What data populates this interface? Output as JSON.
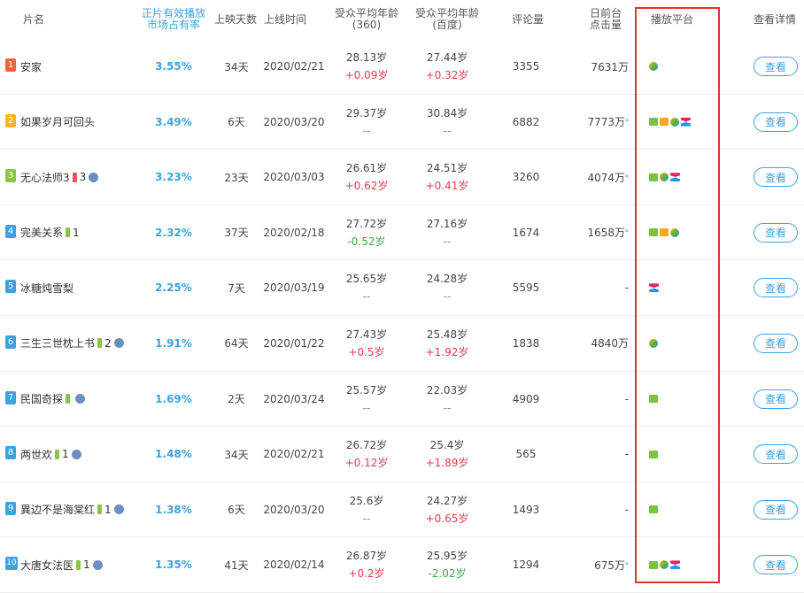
{
  "headers": {
    "name": "片名",
    "share_line1": "正片有效播放",
    "share_line2": "市场占有率",
    "days": "上映天数",
    "date": "上线时间",
    "age360_line1": "受众平均年龄",
    "age360_line2": "(360)",
    "agebaidu_line1": "受众平均年龄",
    "agebaidu_line2": "(百度)",
    "comments": "评论量",
    "views_line1": "日前台",
    "views_line2": "点击量",
    "platform": "播放平台",
    "details": "查看详情"
  },
  "view_button_label": "查看",
  "colors": {
    "accent": "#3ea2dd",
    "up": "#e23c4b",
    "down": "#3aa845",
    "highlight": "#e53030"
  },
  "rows": [
    {
      "rank": "1",
      "rank_color": "#f0663c",
      "title": "安家",
      "badges": [],
      "share": "3.55%",
      "days": "34天",
      "date": "2020/02/21",
      "age360": "28.13岁",
      "age360_delta": "+0.09岁",
      "age360_dir": "up",
      "agebaidu": "27.44岁",
      "agebaidu_delta": "+0.32岁",
      "agebaidu_dir": "up",
      "comments": "3355",
      "views": "7631万",
      "views_mark": "",
      "platforms": [
        "tencent"
      ]
    },
    {
      "rank": "2",
      "rank_color": "#f5b822",
      "title": "如果岁月可回头",
      "badges": [],
      "share": "3.49%",
      "days": "6天",
      "date": "2020/03/20",
      "age360": "29.37岁",
      "age360_delta": "--",
      "age360_dir": "none",
      "agebaidu": "30.84岁",
      "agebaidu_delta": "--",
      "agebaidu_dir": "none",
      "comments": "6882",
      "views": "7773万",
      "views_mark": "*",
      "platforms": [
        "iqiyi",
        "mgtv",
        "tencent",
        "youku"
      ]
    },
    {
      "rank": "3",
      "rank_color": "#8bc34a",
      "title": "无心法师3",
      "badges": [
        {
          "type": "red",
          "num": "3"
        },
        {
          "type": "circle"
        }
      ],
      "share": "3.23%",
      "days": "23天",
      "date": "2020/03/03",
      "age360": "26.61岁",
      "age360_delta": "+0.62岁",
      "age360_dir": "up",
      "agebaidu": "24.51岁",
      "agebaidu_delta": "+0.41岁",
      "agebaidu_dir": "up",
      "comments": "3260",
      "views": "4074万",
      "views_mark": "*",
      "platforms": [
        "iqiyi",
        "tencent",
        "youku"
      ]
    },
    {
      "rank": "4",
      "rank_color": "#3ea2dd",
      "title": "完美关系",
      "badges": [
        {
          "type": "green",
          "num": "1"
        }
      ],
      "share": "2.32%",
      "days": "37天",
      "date": "2020/02/18",
      "age360": "27.72岁",
      "age360_delta": "-0.52岁",
      "age360_dir": "down",
      "agebaidu": "27.16岁",
      "agebaidu_delta": "--",
      "agebaidu_dir": "none",
      "comments": "1674",
      "views": "1658万",
      "views_mark": "*",
      "platforms": [
        "iqiyi",
        "mgtv",
        "tencent"
      ]
    },
    {
      "rank": "5",
      "rank_color": "#3ea2dd",
      "title": "冰糖炖雪梨",
      "badges": [],
      "share": "2.25%",
      "days": "7天",
      "date": "2020/03/19",
      "age360": "25.65岁",
      "age360_delta": "--",
      "age360_dir": "none",
      "agebaidu": "24.28岁",
      "agebaidu_delta": "--",
      "agebaidu_dir": "none",
      "comments": "5595",
      "views": "-",
      "views_mark": "",
      "platforms": [
        "youku"
      ]
    },
    {
      "rank": "6",
      "rank_color": "#3ea2dd",
      "title": "三生三世枕上书",
      "badges": [
        {
          "type": "green",
          "num": "2"
        },
        {
          "type": "circle"
        }
      ],
      "share": "1.91%",
      "days": "64天",
      "date": "2020/01/22",
      "age360": "27.43岁",
      "age360_delta": "+0.5岁",
      "age360_dir": "up",
      "agebaidu": "25.48岁",
      "agebaidu_delta": "+1.92岁",
      "agebaidu_dir": "up",
      "comments": "1838",
      "views": "4840万",
      "views_mark": "",
      "platforms": [
        "tencent"
      ]
    },
    {
      "rank": "7",
      "rank_color": "#3ea2dd",
      "title": "民国奇探",
      "badges": [
        {
          "type": "green",
          "num": ""
        },
        {
          "type": "circle"
        }
      ],
      "share": "1.69%",
      "days": "2天",
      "date": "2020/03/24",
      "age360": "25.57岁",
      "age360_delta": "--",
      "age360_dir": "none",
      "agebaidu": "22.03岁",
      "agebaidu_delta": "--",
      "agebaidu_dir": "none",
      "comments": "4909",
      "views": "-",
      "views_mark": "",
      "platforms": [
        "iqiyi"
      ]
    },
    {
      "rank": "8",
      "rank_color": "#3ea2dd",
      "title": "两世欢",
      "badges": [
        {
          "type": "green",
          "num": "1"
        },
        {
          "type": "circle"
        }
      ],
      "share": "1.48%",
      "days": "34天",
      "date": "2020/02/21",
      "age360": "26.72岁",
      "age360_delta": "+0.12岁",
      "age360_dir": "up",
      "agebaidu": "25.4岁",
      "agebaidu_delta": "+1.89岁",
      "agebaidu_dir": "up",
      "comments": "565",
      "views": "-",
      "views_mark": "",
      "platforms": [
        "iqiyi"
      ]
    },
    {
      "rank": "9",
      "rank_color": "#3ea2dd",
      "title": "異边不是海棠红",
      "badges": [
        {
          "type": "green",
          "num": "1"
        },
        {
          "type": "circle"
        }
      ],
      "share": "1.38%",
      "days": "6天",
      "date": "2020/03/20",
      "age360": "25.6岁",
      "age360_delta": "--",
      "age360_dir": "none",
      "agebaidu": "24.27岁",
      "agebaidu_delta": "+0.65岁",
      "agebaidu_dir": "up",
      "comments": "1493",
      "views": "-",
      "views_mark": "",
      "platforms": [
        "iqiyi"
      ]
    },
    {
      "rank": "10",
      "rank_color": "#3ea2dd",
      "title": "大唐女法医",
      "badges": [
        {
          "type": "green",
          "num": "1"
        },
        {
          "type": "circle"
        }
      ],
      "share": "1.35%",
      "days": "41天",
      "date": "2020/02/14",
      "age360": "26.87岁",
      "age360_delta": "+0.2岁",
      "age360_dir": "up",
      "agebaidu": "25.95岁",
      "agebaidu_delta": "-2.02岁",
      "agebaidu_dir": "down",
      "comments": "1294",
      "views": "675万",
      "views_mark": "*",
      "platforms": [
        "iqiyi",
        "tencent",
        "youku"
      ]
    }
  ]
}
